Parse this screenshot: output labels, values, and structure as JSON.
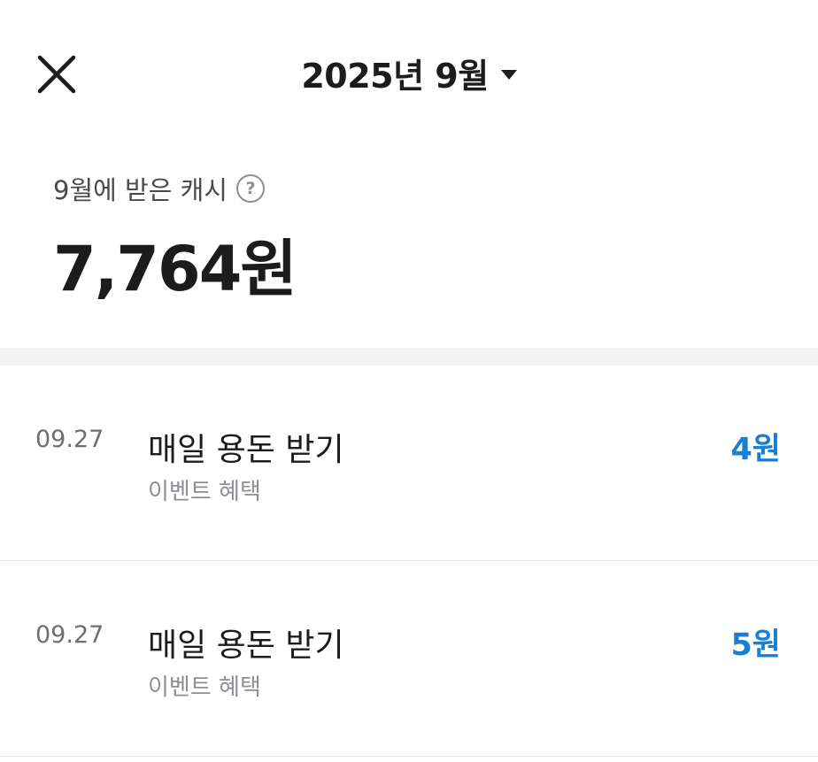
{
  "header": {
    "month_label": "2025년 9월"
  },
  "summary": {
    "label": "9월에 받은 캐시",
    "help_glyph": "?",
    "total": "7,764원"
  },
  "transactions": [
    {
      "date": "09.27",
      "title": "매일 용돈 받기",
      "category": "이벤트 혜택",
      "amount": "4원"
    },
    {
      "date": "09.27",
      "title": "매일 용돈 받기",
      "category": "이벤트 혜택",
      "amount": "5원"
    }
  ],
  "colors": {
    "amount": "#1a7fd4",
    "divider": "#f4f4f5"
  }
}
